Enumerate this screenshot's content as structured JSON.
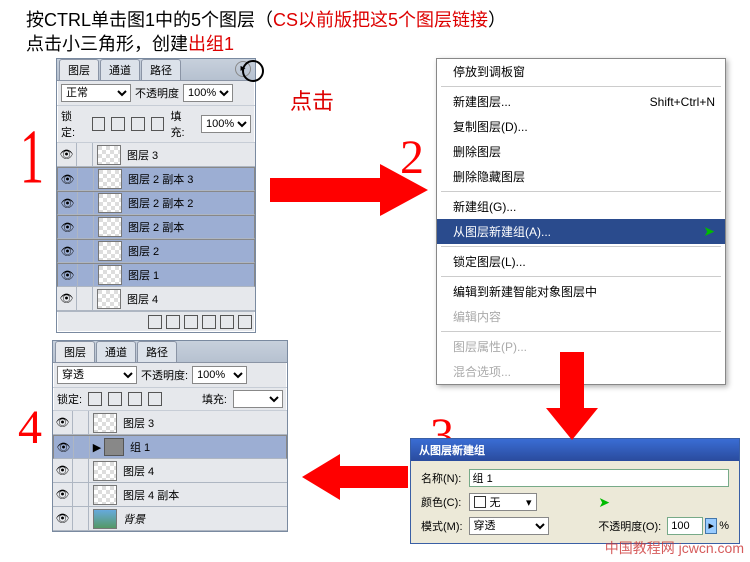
{
  "instructions": {
    "line1_a": "按CTRL单击图1中的5个图层（",
    "line1_b": "CS以前版把这5个图层链接",
    "line1_c": "）",
    "line2_a": "点击小三角形，创建",
    "line2_b": "出组1"
  },
  "labels": {
    "n1": "1",
    "n2": "2",
    "n3": "3",
    "n4": "4",
    "click": "点击"
  },
  "panel1": {
    "tabs": [
      "图层",
      "通道",
      "路径"
    ],
    "mode": "正常",
    "opacity_label": "不透明度",
    "opacity_value": "100%",
    "lock_label": "锁定:",
    "fill_label": "填充:",
    "fill_value": "100%",
    "layers": [
      {
        "name": "图层 3",
        "sel": false
      },
      {
        "name": "图层 2 副本 3",
        "sel": true
      },
      {
        "name": "图层 2 副本 2",
        "sel": true
      },
      {
        "name": "图层 2 副本",
        "sel": true
      },
      {
        "name": "图层 2",
        "sel": true
      },
      {
        "name": "图层 1",
        "sel": true
      },
      {
        "name": "图层 4",
        "sel": false
      }
    ]
  },
  "menu": {
    "items": [
      {
        "t": "停放到调板窗"
      },
      {
        "sep": true
      },
      {
        "t": "新建图层...",
        "k": "Shift+Ctrl+N"
      },
      {
        "t": "复制图层(D)..."
      },
      {
        "t": "删除图层"
      },
      {
        "t": "删除隐藏图层"
      },
      {
        "sep": true
      },
      {
        "t": "新建组(G)..."
      },
      {
        "t": "从图层新建组(A)...",
        "hl": true
      },
      {
        "sep": true
      },
      {
        "t": "锁定图层(L)..."
      },
      {
        "sep": true
      },
      {
        "t": "编辑到新建智能对象图层中"
      },
      {
        "t": "编辑内容",
        "dis": true
      },
      {
        "sep": true
      },
      {
        "t": "图层属性(P)...",
        "dis": true
      },
      {
        "t": "混合选项...",
        "dis": true
      }
    ]
  },
  "panel4": {
    "tabs": [
      "图层",
      "通道",
      "路径"
    ],
    "mode": "穿透",
    "opacity_label": "不透明度:",
    "opacity_value": "100%",
    "lock_label": "锁定:",
    "fill_label": "填充:",
    "fill_value": "",
    "layers": [
      {
        "name": "图层 3",
        "sel": false,
        "thumb": "alpha"
      },
      {
        "name": "组 1",
        "sel": true,
        "group": true
      },
      {
        "name": "图层 4",
        "sel": false,
        "thumb": "alpha"
      },
      {
        "name": "图层 4 副本",
        "sel": false,
        "thumb": "alpha"
      },
      {
        "name": "背景",
        "sel": false,
        "thumb": "bg"
      }
    ]
  },
  "dialog": {
    "title": "从图层新建组",
    "name_label": "名称(N):",
    "name_value": "组 1",
    "color_label": "颜色(C):",
    "color_value": "无",
    "mode_label": "模式(M):",
    "mode_value": "穿透",
    "opacity_label": "不透明度(O):",
    "opacity_value": "100",
    "pct": "%"
  },
  "watermark": "中国教程网 jcwcn.com"
}
